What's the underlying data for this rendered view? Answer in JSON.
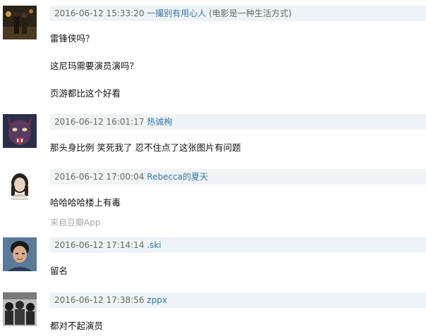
{
  "comments": [
    {
      "time": "2016-06-12 15:33:20",
      "user": "一撮别有用心人",
      "user_suffix": " (电影是一种生活方式)",
      "avatar": "avatar-night-street-photo",
      "lines": [
        "雷锋侠吗？",
        "这尼玛需要演员演吗？",
        "页游都比这个好看"
      ]
    },
    {
      "time": "2016-06-12 16:01:17",
      "user": "热诚栒",
      "user_suffix": "",
      "avatar": "avatar-wolf-photo",
      "lines": [
        "那头身比例 笑死我了 忍不住点了这张图片有问题"
      ]
    },
    {
      "time": "2016-06-12 17:00:04",
      "user": "Rebecca的夏天",
      "user_suffix": "",
      "avatar": "avatar-girl-photo",
      "lines": [
        "哈哈哈哈楼上有毒"
      ],
      "source": "来自豆瓣App"
    },
    {
      "time": "2016-06-12 17:14:14",
      "user": ".ski",
      "user_suffix": "",
      "avatar": "avatar-man-portrait-photo",
      "lines": [
        "留名"
      ]
    },
    {
      "time": "2016-06-12 17:38:56",
      "user": "zppx",
      "user_suffix": "",
      "avatar": "avatar-bw-group-photo",
      "lines": [
        "都对不起演员"
      ]
    }
  ],
  "colors": {
    "meta_bg": "#f0f3f5",
    "link": "#3377aa",
    "time": "#666666",
    "source": "#aaaaaa"
  }
}
